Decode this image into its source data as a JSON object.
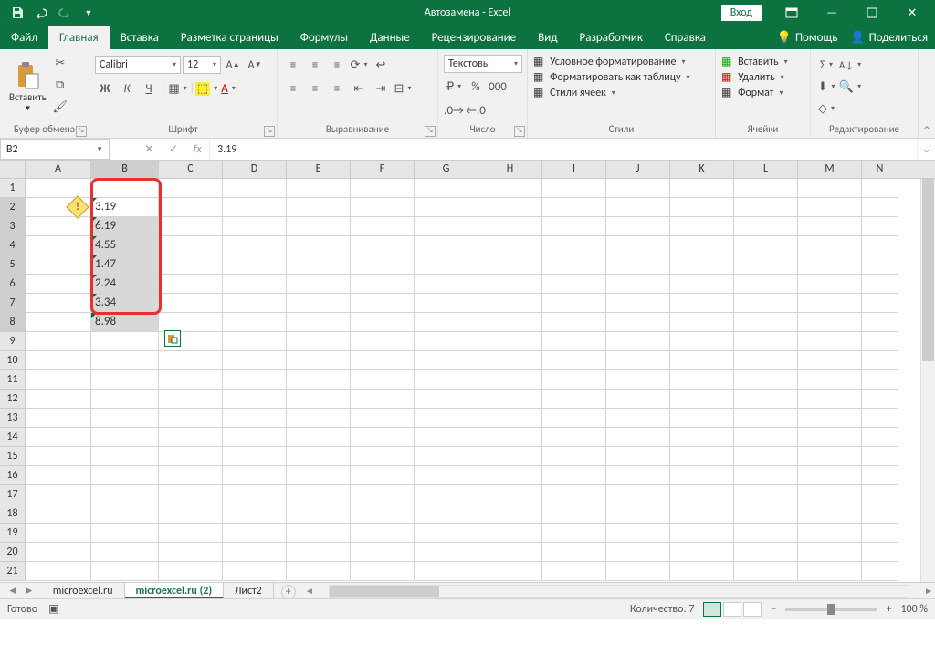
{
  "titlebar": {
    "title": "Автозамена - Excel",
    "login": "Вход"
  },
  "tabs": {
    "file": "Файл",
    "home": "Главная",
    "insert": "Вставка",
    "layout": "Разметка страницы",
    "formulas": "Формулы",
    "data": "Данные",
    "review": "Рецензирование",
    "view": "Вид",
    "dev": "Разработчик",
    "help": "Справка",
    "tellme": "Помощь",
    "share": "Поделиться"
  },
  "ribbon": {
    "clipboard": {
      "label": "Буфер обмена",
      "paste": "Вставить"
    },
    "font": {
      "label": "Шрифт",
      "family": "Calibri",
      "size": "12",
      "bold": "Ж",
      "italic": "К",
      "underline": "Ч"
    },
    "align": {
      "label": "Выравнивание"
    },
    "number": {
      "label": "Число",
      "format": "Текстовы"
    },
    "styles": {
      "label": "Стили",
      "cond": "Условное форматирование",
      "table": "Форматировать как таблицу",
      "cell": "Стили ячеек"
    },
    "cells": {
      "label": "Ячейки",
      "insert": "Вставить",
      "delete": "Удалить",
      "format": "Формат"
    },
    "editing": {
      "label": "Редактирование"
    }
  },
  "formula": {
    "ref": "B2",
    "value": "3.19",
    "fx": "fx"
  },
  "grid": {
    "cols": [
      "A",
      "B",
      "C",
      "D",
      "E",
      "F",
      "G",
      "H",
      "I",
      "J",
      "K",
      "L",
      "M",
      "N"
    ],
    "rows": [
      "1",
      "2",
      "3",
      "4",
      "5",
      "6",
      "7",
      "8",
      "9",
      "10",
      "11",
      "12",
      "13",
      "14",
      "15",
      "16",
      "17",
      "18",
      "19",
      "20",
      "21"
    ],
    "data": [
      "3.19",
      "6.19",
      "4.55",
      "1.47",
      "2.24",
      "3.34",
      "8.98"
    ]
  },
  "sheets": {
    "s1": "microexcel.ru",
    "s2": "microexcel.ru (2)",
    "s3": "Лист2"
  },
  "status": {
    "ready": "Готово",
    "count": "Количество: 7",
    "zoom": "100 %"
  }
}
